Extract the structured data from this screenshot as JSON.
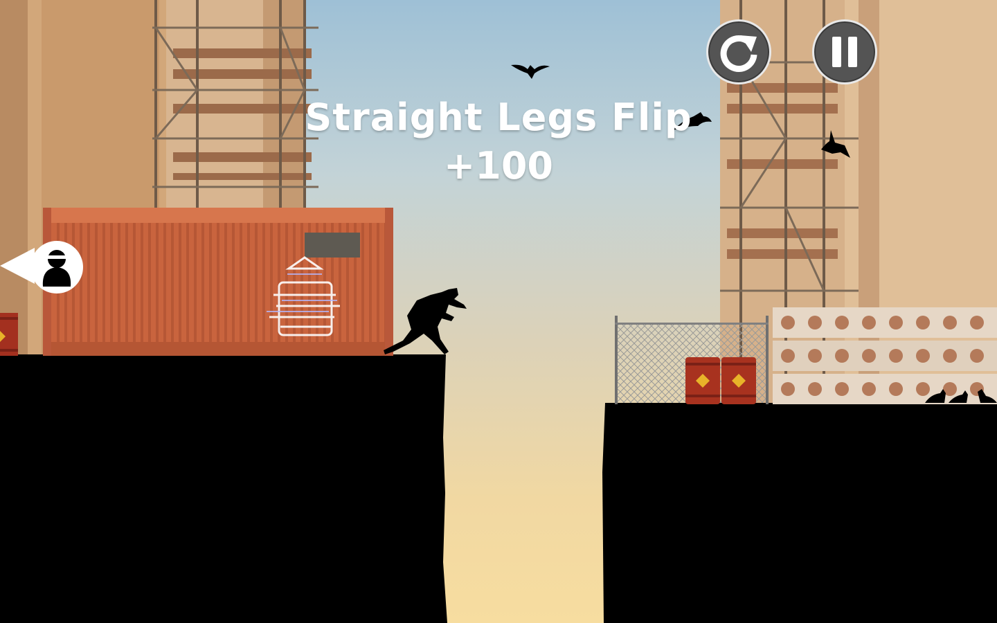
{
  "hud": {
    "restart_icon": "restart-icon",
    "pause_icon": "pause-icon",
    "chaser_icon": "hunter-silhouette-icon"
  },
  "trick": {
    "name": "Straight Legs Flip",
    "points": "+100"
  },
  "colors": {
    "sky_top": "#9ec0d6",
    "sky_bottom": "#f7dda0",
    "container": "#c9643e",
    "silhouette": "#000000",
    "hud_button": "#545454"
  }
}
